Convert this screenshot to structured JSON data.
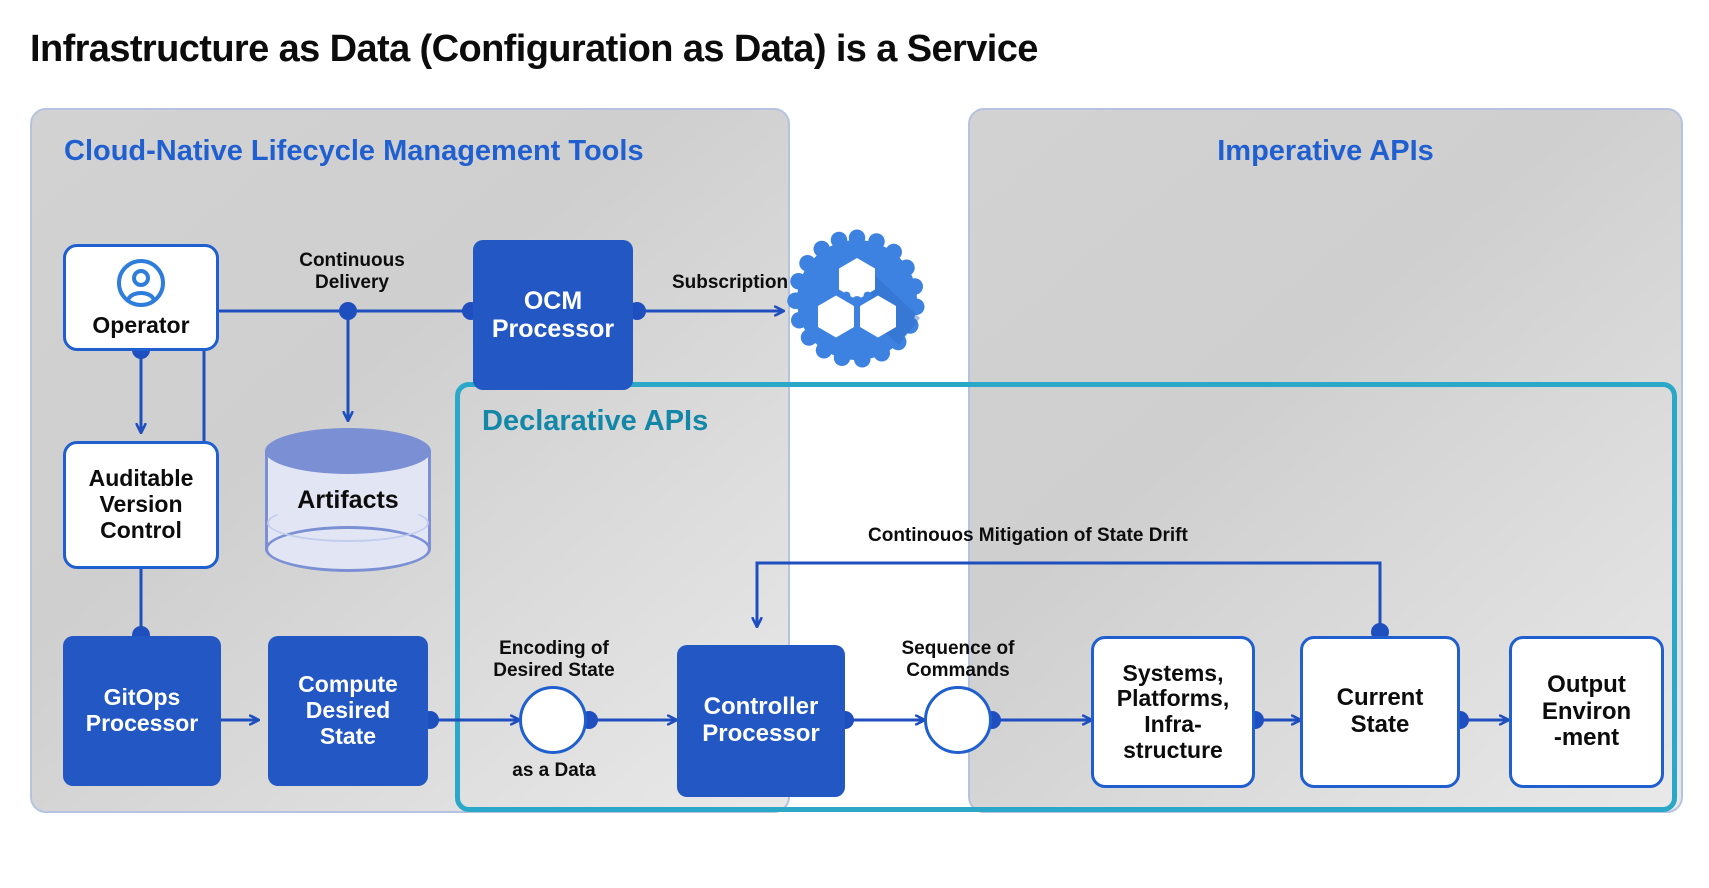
{
  "title": "Infrastructure as Data (Configuration as Data) is a Service",
  "panels": {
    "lifecycle": {
      "title": "Cloud-Native Lifecycle Management Tools"
    },
    "imperative": {
      "title": "Imperative APIs"
    },
    "declarative": {
      "title": "Declarative APIs"
    }
  },
  "nodes": {
    "operator": {
      "label": "Operator",
      "icon": "user-circle-icon"
    },
    "version_control": {
      "label": "Auditable\nVersion\nControl"
    },
    "artifacts": {
      "label": "Artifacts",
      "icon": "database-cylinder-icon"
    },
    "gitops": {
      "label": "GitOps\nProcessor"
    },
    "compute_desired_state": {
      "label": "Compute\nDesired\nState"
    },
    "ocm_processor": {
      "label": "OCM\nProcessor"
    },
    "controller_processor": {
      "label": "Controller\nProcessor"
    },
    "systems": {
      "label": "Systems,\nPlatforms,\nInfra-\nstructure"
    },
    "current_state": {
      "label": "Current\nState"
    },
    "output_env": {
      "label": "Output\nEnviron\n-ment"
    },
    "kubernetes_logo": {
      "icon": "gear-hexagons-logo"
    },
    "encoding_circle": {
      "icon": "empty-circle-node"
    },
    "commands_circle": {
      "icon": "empty-circle-node"
    }
  },
  "edge_labels": {
    "continuous_delivery": "Continuous\nDelivery",
    "subscription": "Subscription",
    "encoding_of_desired_state": "Encoding of\nDesired State",
    "as_a_data": "as a Data",
    "sequence_of_commands": "Sequence of\nCommands",
    "state_drift": "Continouos Mitigation of State Drift"
  },
  "colors": {
    "accent_blue": "#2257c4",
    "edge_blue": "#1f4fbe",
    "teal": "#2ba8c8",
    "teal_text": "#1287a8",
    "panel_title_blue": "#1f5fd0",
    "cylinder_top": "#7b8fd4",
    "cylinder_body": "#e2e6f4",
    "logo_blue": "#3d82e0",
    "text_dark": "#0c0c0c"
  }
}
